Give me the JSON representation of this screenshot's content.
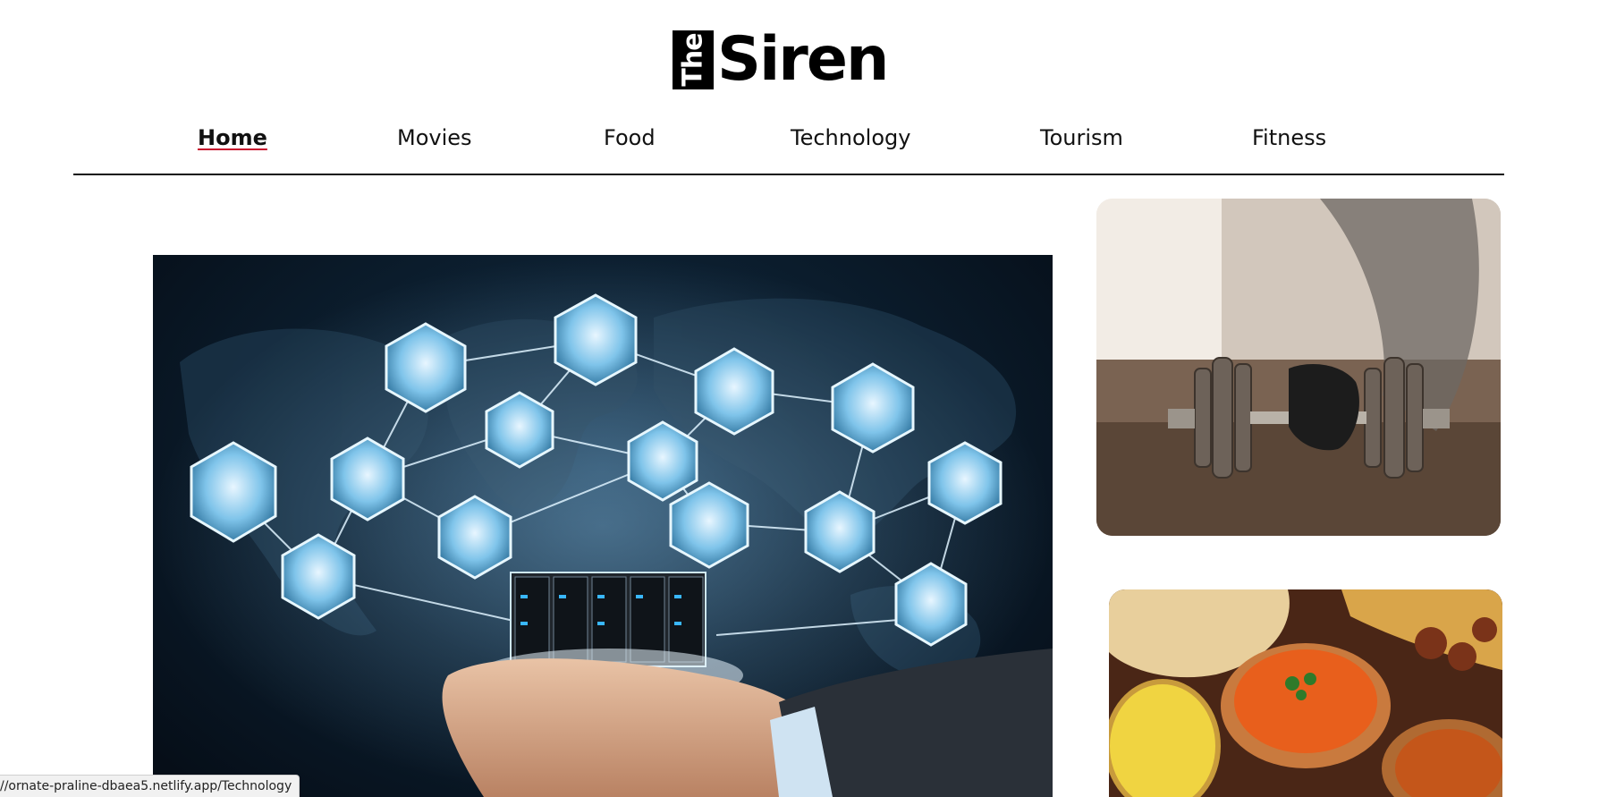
{
  "logo": {
    "mark": "The",
    "word": "Siren"
  },
  "nav": {
    "items": [
      "Home",
      "Movies",
      "Food",
      "Technology",
      "Tourism",
      "Fitness"
    ],
    "active": "Home"
  },
  "images": {
    "hero": "technology-network-image",
    "fitness": "dumbbell-workout-image",
    "food": "indian-curry-food-image"
  },
  "status_bar": {
    "url": "//ornate-praline-dbaea5.netlify.app/Technology"
  },
  "colors": {
    "active_underline": "#c8102e",
    "rule": "#111111"
  }
}
